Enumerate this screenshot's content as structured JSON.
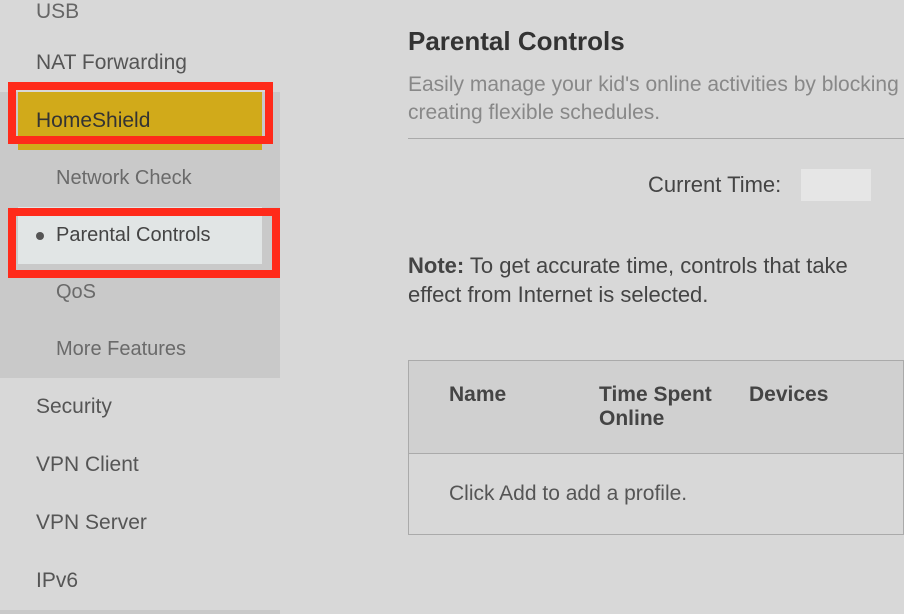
{
  "sidebar": {
    "items": [
      {
        "label": "USB"
      },
      {
        "label": "NAT Forwarding"
      },
      {
        "label": "HomeShield"
      },
      {
        "label": "Network Check"
      },
      {
        "label": "Parental Controls"
      },
      {
        "label": "QoS"
      },
      {
        "label": "More Features"
      },
      {
        "label": "Security"
      },
      {
        "label": "VPN Client"
      },
      {
        "label": "VPN Server"
      },
      {
        "label": "IPv6"
      }
    ]
  },
  "main": {
    "title": "Parental Controls",
    "desc": "Easily manage your kid's online activities by blocking creating flexible schedules.",
    "current_time_label": "Current Time:",
    "note_label": "Note:",
    "note_text": " To get accurate time, controls that take effect from Internet is selected.",
    "table": {
      "col_name": "Name",
      "col_time": "Time Spent Online",
      "col_devices": "Devices",
      "empty": "Click Add to add a profile."
    }
  }
}
